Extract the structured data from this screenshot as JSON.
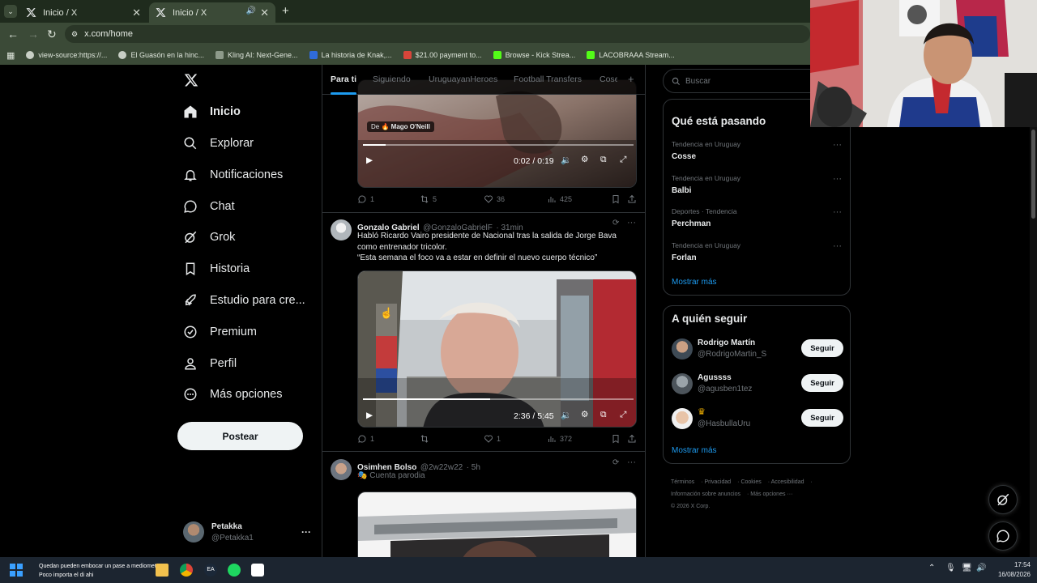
{
  "browser": {
    "tabs": [
      {
        "title": "Inicio / X"
      },
      {
        "title": "Inicio / X"
      }
    ],
    "address": "x.com/home",
    "bookmarks": [
      {
        "label": "view-source:https://..."
      },
      {
        "label": "El Guasón en la hinc..."
      },
      {
        "label": "Kling AI: Next-Gene..."
      },
      {
        "label": "La historia de Knak,..."
      },
      {
        "label": "$21.00 payment to..."
      },
      {
        "label": "Browse - Kick Strea..."
      },
      {
        "label": "LACOBRAAA Stream..."
      }
    ]
  },
  "nav": {
    "items": [
      {
        "label": "Inicio"
      },
      {
        "label": "Explorar"
      },
      {
        "label": "Notificaciones"
      },
      {
        "label": "Chat"
      },
      {
        "label": "Grok"
      },
      {
        "label": "Historia"
      },
      {
        "label": "Estudio para cre..."
      },
      {
        "label": "Premium"
      },
      {
        "label": "Perfil"
      },
      {
        "label": "Más opciones"
      }
    ],
    "post_button": "Postear",
    "account": {
      "name": "Petakka",
      "handle": "@Petakka1",
      "more": "···"
    }
  },
  "feed": {
    "tabs": [
      "Para ti",
      "Siguiendo",
      "UruguayanHeroes",
      "Football Transfers",
      "Cose"
    ],
    "add_tab": "+",
    "tweets": [
      {
        "video_source_prefix": "De",
        "video_source": "Mago O'Neill",
        "video_time": "0:02 / 0:19",
        "replies": "1",
        "reposts": "5",
        "likes": "36",
        "views": "425"
      },
      {
        "name": "Gonzalo Gabriel",
        "handle": "@GonzaloGabrielF",
        "time": "· 31min",
        "text_line1": "Habló Ricardo Vairo presidente de Nacional tras la salida de Jorge Bava",
        "text_line2": "como entrenador tricolor.",
        "text_line3": "“Esta semana el foco va a estar en definir el nuevo cuerpo técnico”",
        "video_time": "2:36 / 5:45",
        "replies": "1",
        "reposts": "",
        "likes": "1",
        "views": "372"
      },
      {
        "name": "Osimhen Bolso",
        "handle": "@2w22w22",
        "time": "· 5h",
        "badge": "Cuenta parodia"
      }
    ]
  },
  "sidebar": {
    "search_placeholder": "Buscar",
    "trends_title": "Qué está pasando",
    "trends": [
      {
        "meta": "Tendencia en Uruguay",
        "name": "Cosse"
      },
      {
        "meta": "Tendencia en Uruguay",
        "name": "Balbi"
      },
      {
        "meta": "Deportes · Tendencia",
        "name": "Perchman"
      },
      {
        "meta": "Tendencia en Uruguay",
        "name": "Forlan"
      }
    ],
    "trends_more": "Mostrar más",
    "follow_title": "A quién seguir",
    "follow": [
      {
        "name": "Rodrigo Martín",
        "handle": "@RodrigoMartin_S",
        "button": "Seguir"
      },
      {
        "name": "Agussss",
        "handle": "@agusben1tez",
        "button": "Seguir"
      },
      {
        "name": "",
        "handle": "@HasbullaUru",
        "button": "Seguir"
      }
    ],
    "follow_more": "Mostrar más",
    "footer": {
      "links": [
        "Términos",
        "Privacidad",
        "Cookies",
        "Accesibilidad",
        "Información sobre anuncios",
        "Más opciones ···"
      ],
      "copyright": "© 2026 X Corp."
    }
  },
  "taskbar": {
    "notification_line1": "Quedan pueden embocar un pase a mediometro",
    "notification_line2": "Poco importa el di ahi",
    "time": "17:54",
    "date": "16/08/2026"
  },
  "colors": {
    "accent": "#1d9bf0",
    "background": "#000000",
    "border": "#2f3336",
    "muted_text": "#71767b",
    "browser_chrome": "#3b4a37"
  }
}
